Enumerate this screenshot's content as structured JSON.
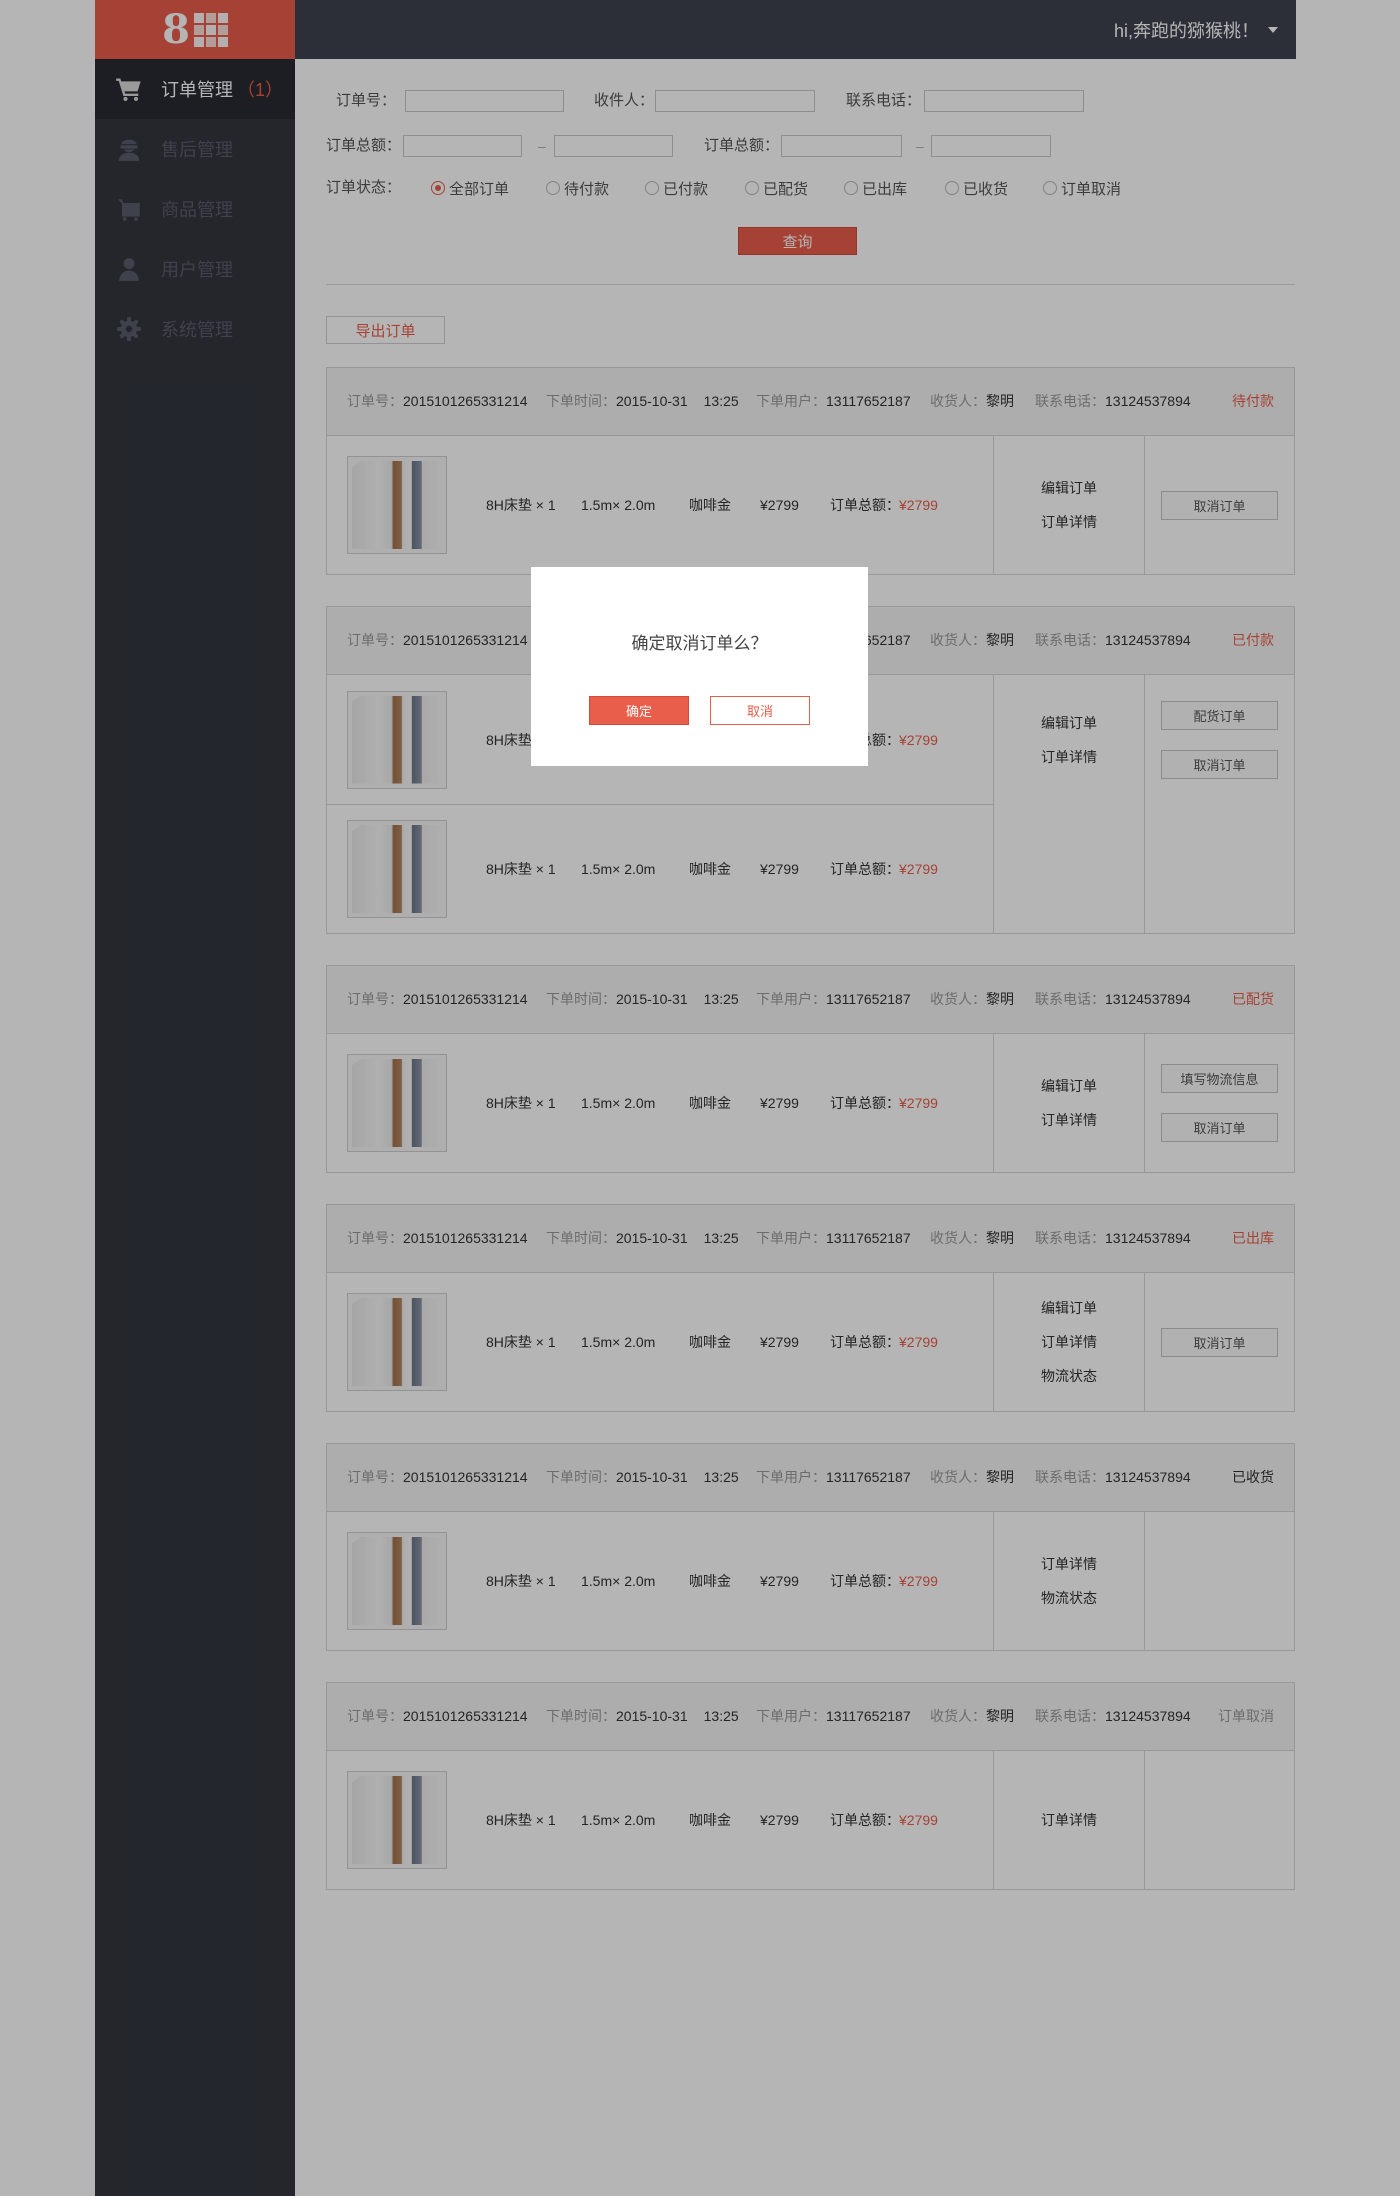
{
  "colors": {
    "accent": "#e95d4b",
    "sidebar": "#33363f",
    "topbar": "#3e424f",
    "overlay": "rgba(0,0,0,0.29)"
  },
  "status_colors": {
    "alert": "#e95d4b",
    "normal": "#333333",
    "muted": "#999999"
  },
  "logo": {
    "text": "8",
    "icon": "grid-icon"
  },
  "topbar": {
    "greeting": "hi,奔跑的猕猴桃！",
    "caret_icon": "caret-down-icon"
  },
  "sidebar": {
    "items": [
      {
        "label": "订单管理",
        "badge": "（1）",
        "icon": "cart-icon",
        "active": true
      },
      {
        "label": "售后管理",
        "icon": "agent-icon",
        "active": false
      },
      {
        "label": "商品管理",
        "icon": "basket-icon",
        "active": false
      },
      {
        "label": "用户管理",
        "icon": "user-icon",
        "active": false
      },
      {
        "label": "系统管理",
        "icon": "gear-icon",
        "active": false
      }
    ]
  },
  "filters": {
    "order_no_label": "订单号：",
    "receiver_label": "收件人：",
    "phone_label": "联系电话：",
    "total_label": "订单总额：",
    "total_label_2": "订单总额：",
    "range_sep": "–",
    "status_label": "订单状态：",
    "status_options": [
      "全部订单",
      "待付款",
      "已付款",
      "已配货",
      "已出库",
      "已收货",
      "订单取消"
    ],
    "status_selected": "全部订单",
    "query_button": "查询"
  },
  "export_button": "导出订单",
  "order_labels": {
    "order_no": "订单号：",
    "time": "下单时间：",
    "user": "下单用户：",
    "receiver": "收货人：",
    "phone": "联系电话：",
    "total": "订单总额："
  },
  "orders": [
    {
      "order_no": "2015101265331214",
      "date": "2015-10-31",
      "time": "13:25",
      "user": "13117652187",
      "receiver": "黎明",
      "phone": "13124537894",
      "status": "待付款",
      "status_tone": "alert",
      "items": [
        {
          "name": "8H床垫 × 1",
          "size": "1.5m× 2.0m",
          "color": "咖啡金",
          "price": "¥2799",
          "total": "¥2799"
        }
      ],
      "actions": [
        "编辑订单",
        "订单详情"
      ],
      "buttons": [
        "取消订单"
      ]
    },
    {
      "order_no": "2015101265331214",
      "date": "2015-10-31",
      "time": "13:25",
      "user": "13117652187",
      "receiver": "黎明",
      "phone": "13124537894",
      "status": "已付款",
      "status_tone": "alert",
      "items": [
        {
          "name": "8H床垫 × 1",
          "size": "1.5m× 2.0m",
          "color": "咖啡金",
          "price": "¥2799",
          "total": "¥2799"
        },
        {
          "name": "8H床垫 × 1",
          "size": "1.5m× 2.0m",
          "color": "咖啡金",
          "price": "¥2799",
          "total": "¥2799"
        }
      ],
      "actions": [
        "编辑订单",
        "订单详情"
      ],
      "buttons": [
        "配货订单",
        "取消订单"
      ]
    },
    {
      "order_no": "2015101265331214",
      "date": "2015-10-31",
      "time": "13:25",
      "user": "13117652187",
      "receiver": "黎明",
      "phone": "13124537894",
      "status": "已配货",
      "status_tone": "alert",
      "items": [
        {
          "name": "8H床垫 × 1",
          "size": "1.5m× 2.0m",
          "color": "咖啡金",
          "price": "¥2799",
          "total": "¥2799"
        }
      ],
      "actions": [
        "编辑订单",
        "订单详情"
      ],
      "buttons": [
        "填写物流信息",
        "取消订单"
      ]
    },
    {
      "order_no": "2015101265331214",
      "date": "2015-10-31",
      "time": "13:25",
      "user": "13117652187",
      "receiver": "黎明",
      "phone": "13124537894",
      "status": "已出库",
      "status_tone": "alert",
      "items": [
        {
          "name": "8H床垫 × 1",
          "size": "1.5m× 2.0m",
          "color": "咖啡金",
          "price": "¥2799",
          "total": "¥2799"
        }
      ],
      "actions": [
        "编辑订单",
        "订单详情",
        "物流状态"
      ],
      "buttons": [
        "取消订单"
      ]
    },
    {
      "order_no": "2015101265331214",
      "date": "2015-10-31",
      "time": "13:25",
      "user": "13117652187",
      "receiver": "黎明",
      "phone": "13124537894",
      "status": "已收货",
      "status_tone": "normal",
      "items": [
        {
          "name": "8H床垫 × 1",
          "size": "1.5m× 2.0m",
          "color": "咖啡金",
          "price": "¥2799",
          "total": "¥2799"
        }
      ],
      "actions": [
        "订单详情",
        "物流状态"
      ],
      "buttons": []
    },
    {
      "order_no": "2015101265331214",
      "date": "2015-10-31",
      "time": "13:25",
      "user": "13117652187",
      "receiver": "黎明",
      "phone": "13124537894",
      "status": "订单取消",
      "status_tone": "muted",
      "items": [
        {
          "name": "8H床垫 × 1",
          "size": "1.5m× 2.0m",
          "color": "咖啡金",
          "price": "¥2799",
          "total": "¥2799"
        }
      ],
      "actions": [
        "订单详情"
      ],
      "buttons": []
    }
  ],
  "modal": {
    "message": "确定取消订单么？",
    "confirm": "确定",
    "cancel": "取消"
  }
}
